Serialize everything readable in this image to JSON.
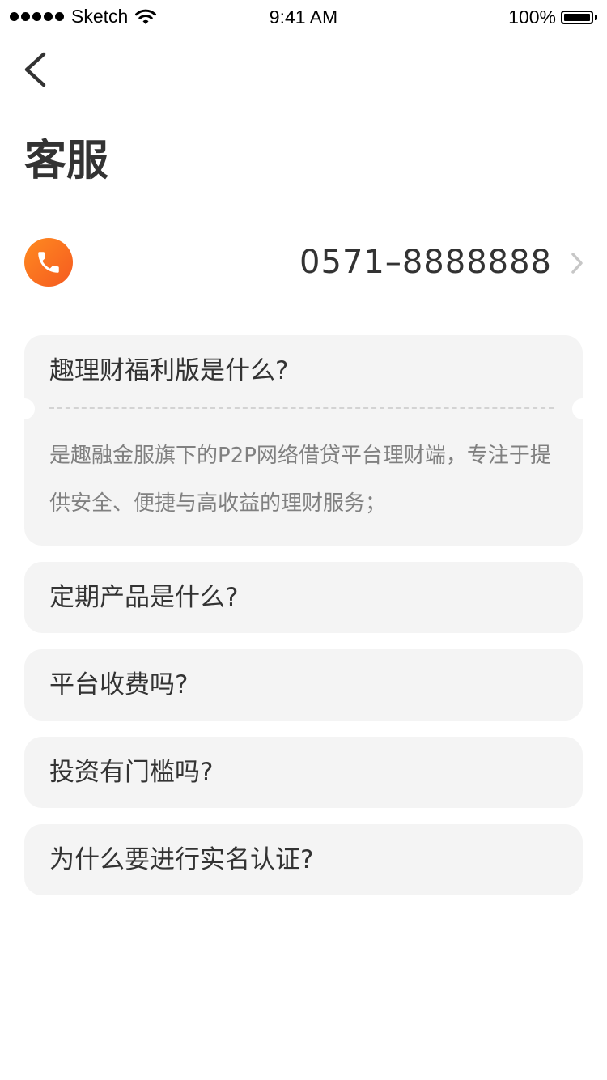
{
  "status_bar": {
    "carrier": "Sketch",
    "time": "9:41 AM",
    "battery": "100%"
  },
  "nav": {
    "back_icon": "chevron-left-icon"
  },
  "page": {
    "title": "客服"
  },
  "phone": {
    "icon": "phone-icon",
    "number": "0571–8888888",
    "icon_color_start": "#ff8a1f",
    "icon_color_end": "#f55a21"
  },
  "faq": [
    {
      "question": "趣理财福利版是什么?",
      "answer": "是趣融金服旗下的P2P网络借贷平台理财端，专注于提供安全、便捷与高收益的理财服务；",
      "expanded": true
    },
    {
      "question": "定期产品是什么?",
      "expanded": false
    },
    {
      "question": "平台收费吗?",
      "expanded": false
    },
    {
      "question": "投资有门槛吗?",
      "expanded": false
    },
    {
      "question": "为什么要进行实名认证?",
      "expanded": false
    }
  ],
  "colors": {
    "card_background": "#f4f4f4",
    "text_primary": "#333333",
    "text_secondary": "#808080",
    "chevron": "#c7c7c7"
  }
}
